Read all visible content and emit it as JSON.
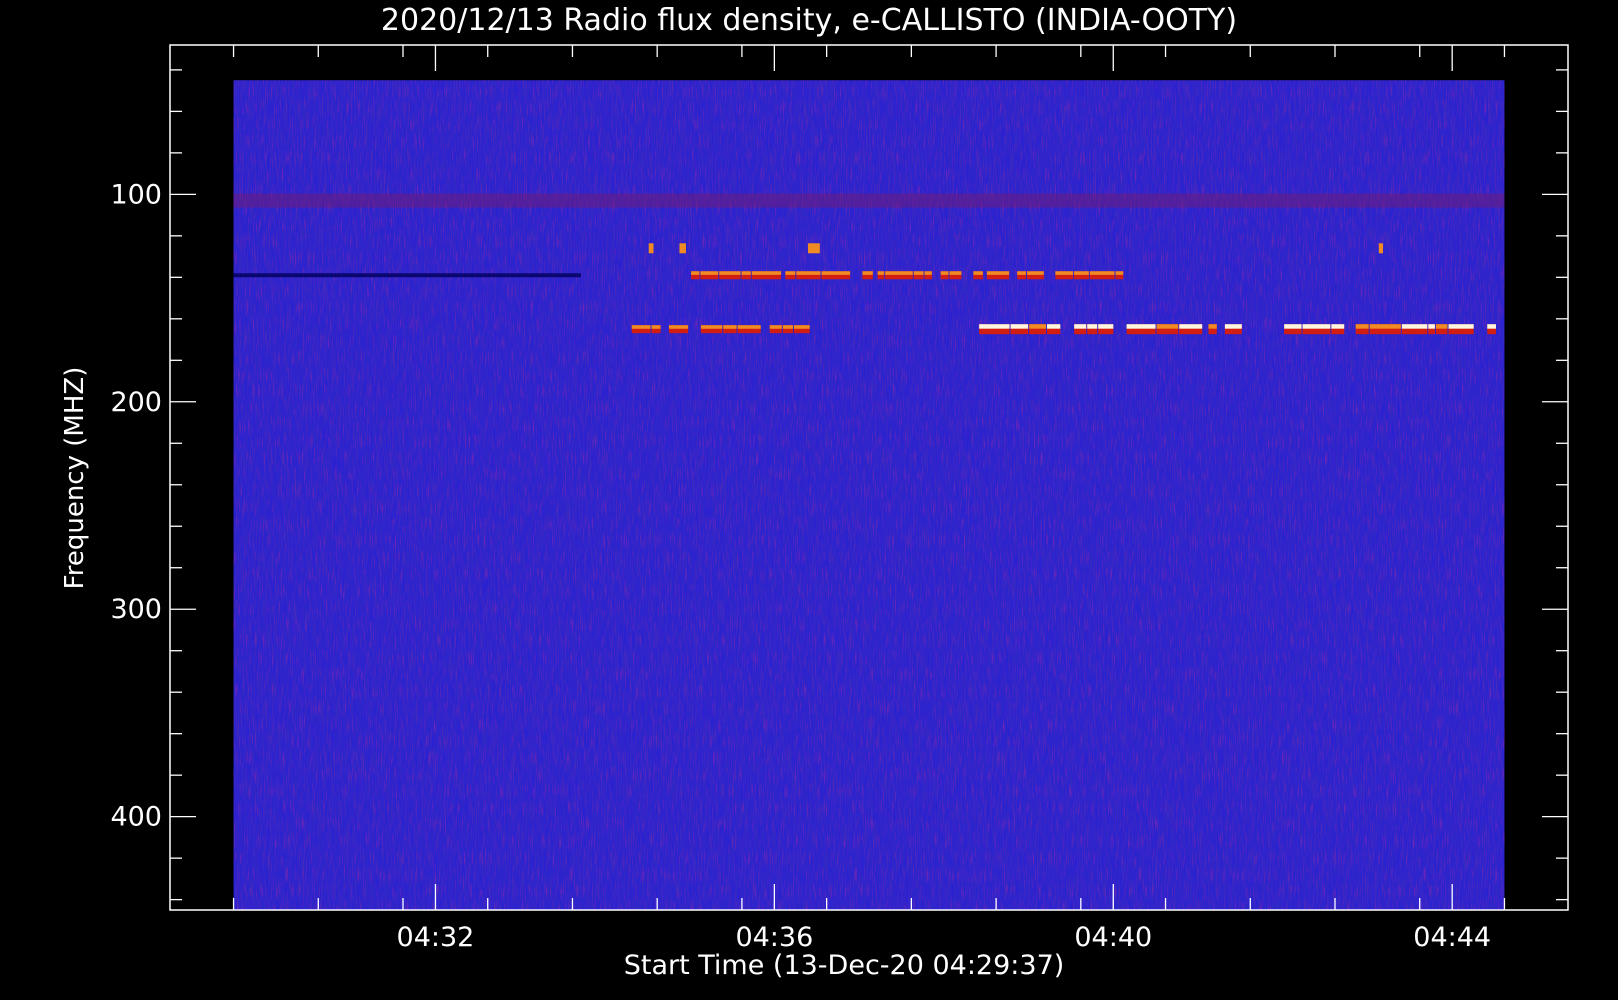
{
  "chart_data": {
    "type": "heatmap",
    "title": "2020/12/13  Radio flux density, e-CALLISTO (INDIA-OOTY)",
    "xlabel": "Start Time (13-Dec-20 04:29:37)",
    "ylabel": "Frequency (MHZ)",
    "x_tick_labels": [
      "04:32",
      "04:36",
      "04:40",
      "04:44"
    ],
    "x_ticks_minutes": [
      2.383,
      6.383,
      10.383,
      14.383
    ],
    "xlim_minutes": [
      -0.75,
      15.75
    ],
    "y_tick_labels": [
      "100",
      "200",
      "300",
      "400"
    ],
    "y_ticks": [
      100,
      200,
      300,
      400
    ],
    "ylim": [
      445,
      28
    ],
    "data_ylim": [
      445,
      45
    ],
    "data_xlim_minutes": [
      0,
      15.0
    ],
    "y_scale": "linear",
    "y_inverted": true,
    "grid": false,
    "colors": {
      "background": "#000000",
      "frame": "#ffffff",
      "spectrogram_base": "#2a22d0",
      "noise_dark": "#1a14b0",
      "noise_red": "#7a1a6a",
      "burst_red": "#d21d12",
      "burst_orange": "#f08a22",
      "burst_white": "#fff6e0"
    },
    "features": [
      {
        "name": "interference band",
        "freq_mhz": 165,
        "t_min": 4.7,
        "t_max": 6.8,
        "intensity": "high"
      },
      {
        "name": "interference band",
        "freq_mhz": 165,
        "t_min": 8.8,
        "t_max": 11.9,
        "intensity": "very high"
      },
      {
        "name": "interference band",
        "freq_mhz": 165,
        "t_min": 12.4,
        "t_max": 14.9,
        "intensity": "very high"
      },
      {
        "name": "interference band",
        "freq_mhz": 139,
        "t_min": 5.4,
        "t_max": 10.5,
        "intensity": "high"
      },
      {
        "name": "dark absorption line",
        "freq_mhz": 139,
        "t_min": 0.0,
        "t_max": 4.1,
        "intensity": "low"
      },
      {
        "name": "intermittent band",
        "freq_mhz": 126,
        "t_min": 4.9,
        "t_max": 13.6,
        "intensity": "medium"
      },
      {
        "name": "broadband noise band",
        "freq_mhz": 103,
        "t_min": 0.0,
        "t_max": 15.0,
        "intensity": "medium"
      }
    ]
  }
}
